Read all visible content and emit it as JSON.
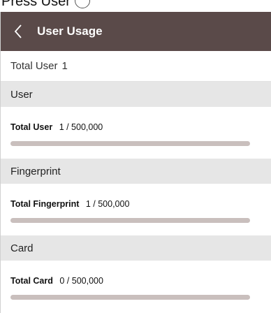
{
  "partial_heading": {
    "text": "Press User"
  },
  "header": {
    "title": "User Usage",
    "back_icon": "chevron-left-icon"
  },
  "summary": {
    "label": "Total User",
    "value": "1"
  },
  "sections": [
    {
      "title": "User",
      "item_label": "Total User",
      "item_value": "1 / 500,000",
      "progress": 2e-06
    },
    {
      "title": "Fingerprint",
      "item_label": "Total Fingerprint",
      "item_value": "1 / 500,000",
      "progress": 2e-06
    },
    {
      "title": "Card",
      "item_label": "Total Card",
      "item_value": "0 / 500,000",
      "progress": 0
    }
  ],
  "colors": {
    "header_bg": "#5a4a49",
    "section_bg": "#e6e6e6",
    "bar_track": "#c9bfbd"
  }
}
